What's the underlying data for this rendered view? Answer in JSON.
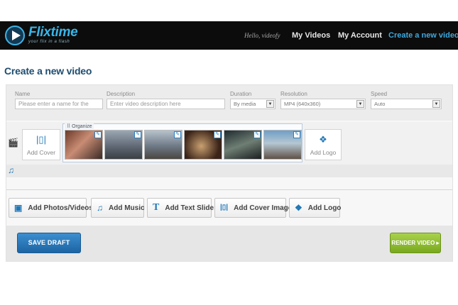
{
  "app": {
    "brand": "Flixtime",
    "tagline": "your flix in a flash",
    "greeting": "Hello, videofy"
  },
  "nav": {
    "my_videos": "My Videos",
    "my_account": "My Account",
    "create": "Create a new video",
    "active_color": "#3fa8dc"
  },
  "page": {
    "title": "Create a new video"
  },
  "fields": {
    "name": {
      "label": "Name",
      "placeholder": "Please enter a name for the"
    },
    "description": {
      "label": "Description",
      "placeholder": "Enter video description here"
    },
    "duration": {
      "label": "Duration",
      "value": "By media"
    },
    "resolution": {
      "label": "Resolution",
      "value": "MP4 (640x360)"
    },
    "speed": {
      "label": "Speed",
      "value": "Auto"
    }
  },
  "timeline": {
    "video_track_icon": "film-icon",
    "music_track_icon": "music-note-icon",
    "add_cover_label": "Add Cover",
    "organize_label": "Organize",
    "add_logo_label": "Add Logo",
    "thumbnails": [
      {
        "bg": "linear-gradient(135deg,#6b3b2a,#c98c74 45%,#3a2a25)"
      },
      {
        "bg": "linear-gradient(180deg,#9aa7b3,#5c6470 60%,#3b3f44)"
      },
      {
        "bg": "linear-gradient(180deg,#b6c2cc,#6e7986 55%,#4a4640)"
      },
      {
        "bg": "radial-gradient(circle at 45% 55%,#c9a070,#3a2318 70%)"
      },
      {
        "bg": "linear-gradient(160deg,#1f2a2f,#6f7f74 50%,#1a1d1f)"
      },
      {
        "bg": "linear-gradient(180deg,#6f9ec7,#b5c7d2 45%,#5e5246)"
      }
    ]
  },
  "actions": {
    "add_photos": "Add Photos/Videos",
    "add_music": "Add Music",
    "add_text": "Add Text Slide",
    "add_cover_image": "Add Cover Image",
    "add_logo": "Add Logo"
  },
  "footer": {
    "save_label": "SAVE DRAFT",
    "render_label": "RENDER VIDEO ▸",
    "save_color": "#1f70b5",
    "render_color": "#8cbf2a"
  }
}
